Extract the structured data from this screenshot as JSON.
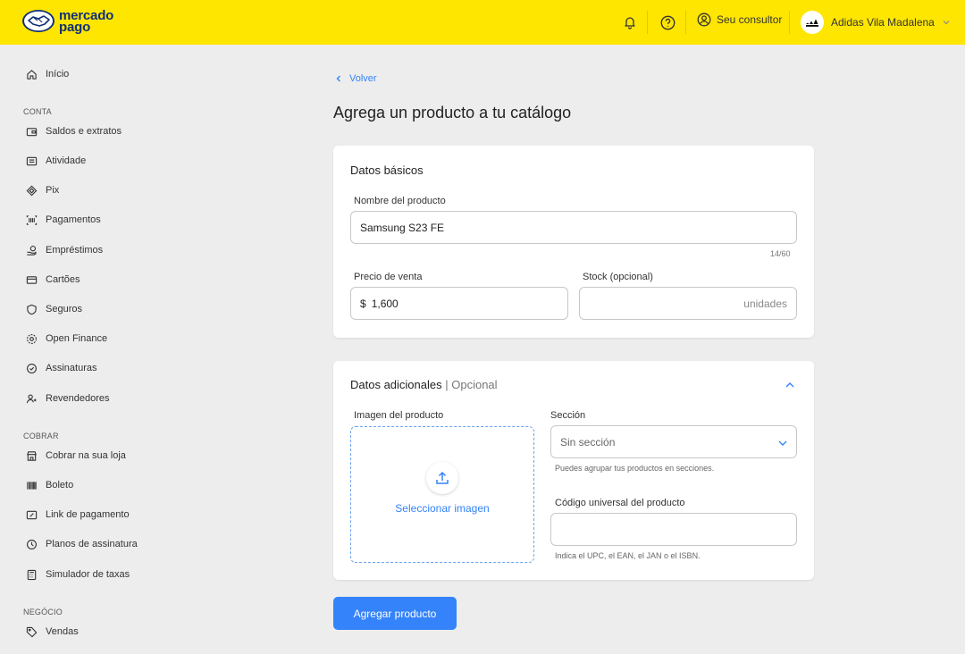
{
  "header": {
    "logo_line1": "mercado",
    "logo_line2": "pago",
    "consultor_label": "Seu consultor",
    "account_name": "Adidas Vila Madalena"
  },
  "sidebar": {
    "inicio": "Início",
    "section_conta": "CONTA",
    "conta_items": [
      {
        "label": "Saldos e extratos",
        "icon": "wallet-icon"
      },
      {
        "label": "Atividade",
        "icon": "list-icon"
      },
      {
        "label": "Pix",
        "icon": "pix-icon"
      },
      {
        "label": "Pagamentos",
        "icon": "barcode-payments-icon"
      },
      {
        "label": "Empréstimos",
        "icon": "loan-icon"
      },
      {
        "label": "Cartões",
        "icon": "card-icon"
      },
      {
        "label": "Seguros",
        "icon": "shield-icon"
      },
      {
        "label": "Open Finance",
        "icon": "open-finance-icon"
      },
      {
        "label": "Assinaturas",
        "icon": "subscription-icon"
      },
      {
        "label": "Revendedores",
        "icon": "resellers-icon"
      }
    ],
    "section_cobrar": "COBRAR",
    "cobrar_items": [
      {
        "label": "Cobrar na sua loja",
        "icon": "store-icon"
      },
      {
        "label": "Boleto",
        "icon": "barcode-icon"
      },
      {
        "label": "Link de pagamento",
        "icon": "link-icon"
      },
      {
        "label": "Planos de assinatura",
        "icon": "plans-icon"
      },
      {
        "label": "Simulador de taxas",
        "icon": "calculator-icon"
      }
    ],
    "section_negocio": "NEGÓCIO",
    "negocio_items": [
      {
        "label": "Vendas",
        "icon": "tag-icon"
      }
    ]
  },
  "main": {
    "back_label": "Volver",
    "title": "Agrega un producto a tu catálogo",
    "basic": {
      "title": "Datos básicos",
      "name_label": "Nombre del producto",
      "name_value": "Samsung S23 FE",
      "name_counter": "14/60",
      "price_label": "Precio de venta",
      "currency": "$",
      "price_value": "1,600",
      "stock_label": "Stock (opcional)",
      "stock_placeholder": "unidades"
    },
    "additional": {
      "title": "Datos adicionales",
      "title_suffix": "| Opcional",
      "image_label": "Imagen del producto",
      "image_action": "Seleccionar imagen",
      "section_label": "Sección",
      "section_value": "Sin sección",
      "section_help": "Puedes agrupar tus productos en secciones.",
      "code_label": "Código universal del producto",
      "code_value": "",
      "code_help": "Indica el UPC, el EAN, el JAN o el ISBN."
    },
    "submit_label": "Agregar producto"
  },
  "colors": {
    "brand_yellow": "#ffe600",
    "accent_blue": "#3483fa",
    "logo_navy": "#102f78",
    "background": "#ededed"
  }
}
